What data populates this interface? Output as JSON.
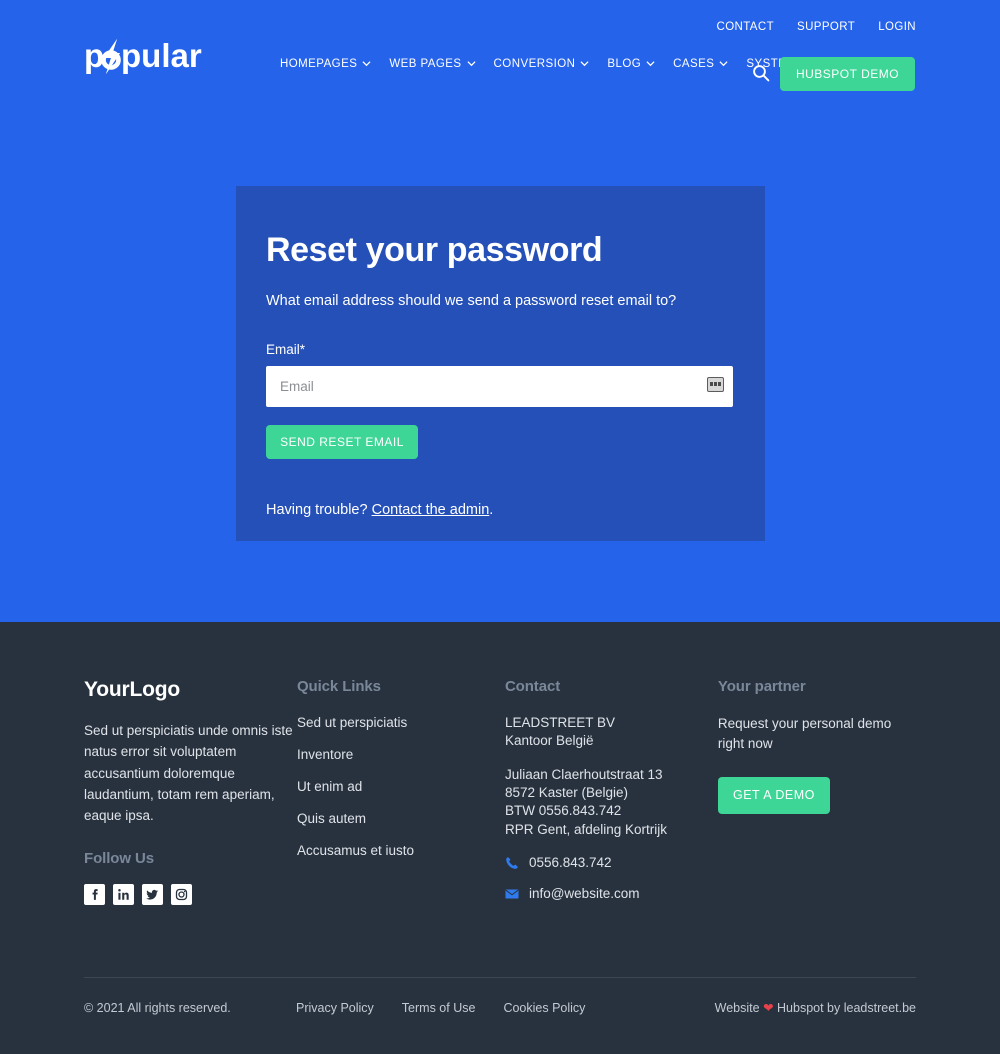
{
  "colors": {
    "hero_blue": "#2563eb",
    "card_blue": "#2450b8",
    "accent_green": "#3ed696",
    "footer_dark": "#28323f",
    "heading_muted": "#7a8799",
    "heart_red": "#e8414a"
  },
  "header": {
    "logo_text": "popular",
    "top_links": [
      {
        "label": "CONTACT"
      },
      {
        "label": "SUPPORT"
      },
      {
        "label": "LOGIN"
      }
    ],
    "nav": [
      {
        "label": "HOMEPAGES",
        "has_caret": true
      },
      {
        "label": "WEB PAGES",
        "has_caret": true
      },
      {
        "label": "CONVERSION",
        "has_caret": true
      },
      {
        "label": "BLOG",
        "has_caret": true
      },
      {
        "label": "CASES",
        "has_caret": true
      },
      {
        "label": "SYSTEM",
        "has_caret": true
      }
    ],
    "search_icon": "search-icon",
    "cta_label": "HUBSPOT DEMO"
  },
  "card": {
    "title": "Reset your password",
    "subtitle": "What email address should we send a password reset email to?",
    "email_label": "Email*",
    "email_value": "",
    "email_placeholder": "Email",
    "autofill_icon": "autofill-icon",
    "submit_label": "SEND RESET EMAIL",
    "trouble_prefix": "Having trouble? ",
    "trouble_link": "Contact the admin",
    "trouble_suffix": "."
  },
  "footer": {
    "brand": {
      "logo_text": "YourLogo",
      "description": "Sed ut perspiciatis unde omnis iste natus error sit voluptatem accusantium doloremque laudantium, totam rem aperiam, eaque ipsa."
    },
    "quick_links": {
      "heading": "Quick Links",
      "items": [
        {
          "label": "Sed ut perspiciatis"
        },
        {
          "label": "Inventore"
        },
        {
          "label": "Ut enim ad"
        },
        {
          "label": "Quis autem"
        },
        {
          "label": "Accusamus et iusto"
        }
      ]
    },
    "contact": {
      "heading": "Contact",
      "company_line1": "LEADSTREET BV",
      "company_line2": "Kantoor België",
      "address_line1": "Juliaan Claerhoutstraat 13",
      "address_line2": "8572 Kaster (Belgie)",
      "address_line3": "BTW 0556.843.742",
      "address_line4": "RPR Gent, afdeling Kortrijk",
      "phone": "0556.843.742",
      "phone_icon": "phone-icon",
      "email": "info@website.com",
      "email_icon": "envelope-icon"
    },
    "partner": {
      "heading": "Your partner",
      "text": "Request your personal demo right now",
      "cta_label": "GET A DEMO"
    },
    "follow": {
      "heading": "Follow Us",
      "socials": [
        {
          "name": "facebook-icon"
        },
        {
          "name": "linkedin-icon"
        },
        {
          "name": "twitter-icon"
        },
        {
          "name": "instagram-icon"
        }
      ]
    },
    "bottom": {
      "copyright": "© 2021 All rights reserved.",
      "legal": [
        {
          "label": "Privacy Policy"
        },
        {
          "label": "Terms of Use"
        },
        {
          "label": "Cookies Policy"
        }
      ],
      "credit_prefix": "Website ",
      "credit_heart": "❤",
      "credit_suffix": " Hubspot by leadstreet.be"
    }
  }
}
